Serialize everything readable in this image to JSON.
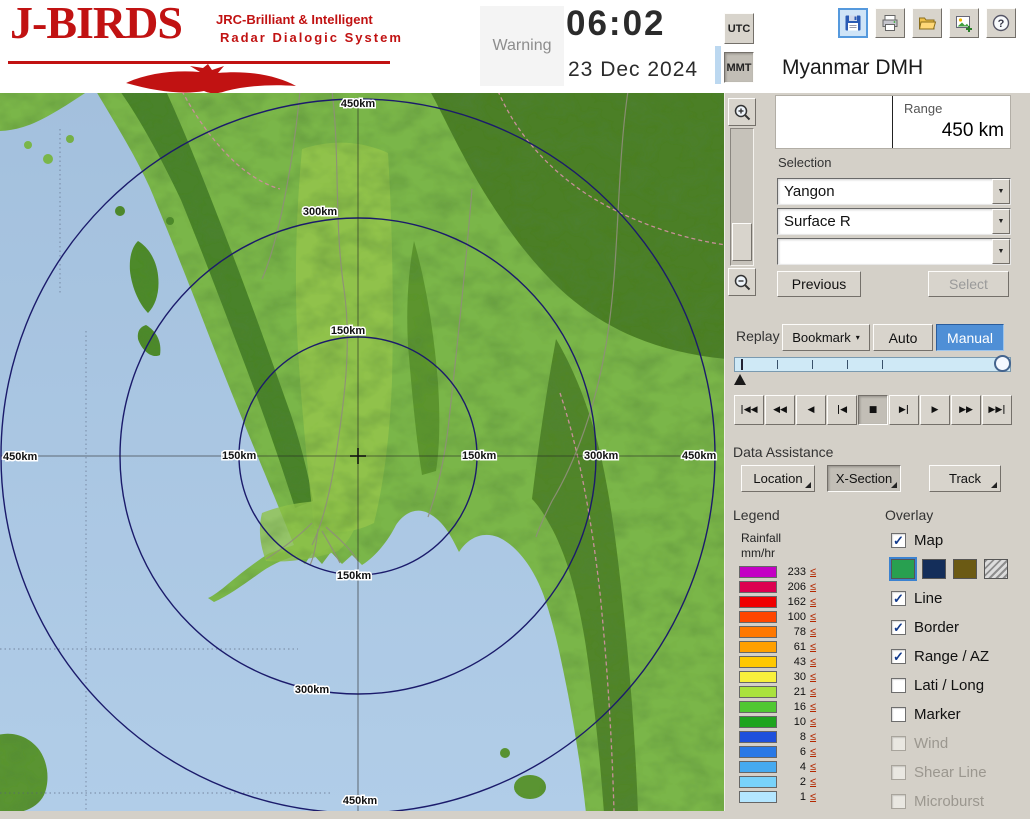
{
  "header": {
    "app_title": "J-BIRDS",
    "tagline_line1": "JRC-Brilliant & Intelligent",
    "tagline_line2": "Radar  Dialogic  System",
    "warning_label": "Warning",
    "time": "06:02",
    "date": "23 Dec 2024",
    "timezone_utc": "UTC",
    "timezone_mmt": "MMT",
    "selected_timezone": "MMT",
    "station_title": "Myanmar DMH",
    "toolbar_icons": [
      "save",
      "print",
      "open",
      "export",
      "help"
    ]
  },
  "range_panel": {
    "label": "Range",
    "value": "450 km"
  },
  "selection": {
    "label": "Selection",
    "dropdowns": [
      "Yangon",
      "Surface R",
      ""
    ],
    "previous_button": "Previous",
    "select_button": "Select",
    "select_enabled": false
  },
  "replay": {
    "label": "Replay",
    "bookmark_button": "Bookmark",
    "auto_button": "Auto",
    "manual_button": "Manual",
    "selected_mode": "Manual",
    "playback": [
      "|◀◀",
      "◀◀",
      "◀",
      "|◀",
      "■",
      "▶|",
      "▶",
      "▶▶",
      "▶▶|"
    ],
    "playback_names": [
      "skip-to-start",
      "fast-rewind",
      "play-reverse",
      "step-back",
      "stop",
      "step-forward",
      "play",
      "fast-forward",
      "skip-to-end"
    ],
    "pressed_index": 4
  },
  "data_assistance": {
    "label": "Data Assistance",
    "buttons": [
      "Location",
      "X-Section",
      "Track"
    ],
    "active_index": 1
  },
  "legend": {
    "title": "Legend",
    "parameter": "Rainfall",
    "unit": "mm/hr",
    "le_symbol": "≤",
    "entries": [
      {
        "value": "233",
        "color": "#c400c4"
      },
      {
        "value": "206",
        "color": "#dc0050"
      },
      {
        "value": "162",
        "color": "#f00000"
      },
      {
        "value": "100",
        "color": "#ff4600"
      },
      {
        "value": "78",
        "color": "#ff7800"
      },
      {
        "value": "61",
        "color": "#ffa000"
      },
      {
        "value": "43",
        "color": "#ffc800"
      },
      {
        "value": "30",
        "color": "#f8f03c"
      },
      {
        "value": "21",
        "color": "#aae23c"
      },
      {
        "value": "16",
        "color": "#50c832"
      },
      {
        "value": "10",
        "color": "#1ea41e"
      },
      {
        "value": "8",
        "color": "#1e50dc"
      },
      {
        "value": "6",
        "color": "#2878e6"
      },
      {
        "value": "4",
        "color": "#46aaf0"
      },
      {
        "value": "2",
        "color": "#78d2fa"
      },
      {
        "value": "1",
        "color": "#b4e6ff"
      }
    ]
  },
  "overlay": {
    "title": "Overlay",
    "items": [
      {
        "label": "Map",
        "checked": true,
        "enabled": true
      },
      {
        "label": "Line",
        "checked": true,
        "enabled": true
      },
      {
        "label": "Border",
        "checked": true,
        "enabled": true
      },
      {
        "label": "Range / AZ",
        "checked": true,
        "enabled": true
      },
      {
        "label": "Lati / Long",
        "checked": false,
        "enabled": true
      },
      {
        "label": "Marker",
        "checked": false,
        "enabled": true
      },
      {
        "label": "Wind",
        "checked": false,
        "enabled": false
      },
      {
        "label": "Shear Line",
        "checked": false,
        "enabled": false
      },
      {
        "label": "Microburst",
        "checked": false,
        "enabled": false
      }
    ],
    "map_style_swatches": [
      {
        "color": "#28a050",
        "selected": true
      },
      {
        "color": "#142e5a",
        "selected": false
      },
      {
        "color": "#6b5a14",
        "selected": false
      },
      {
        "color": "hatch",
        "selected": false
      }
    ]
  },
  "map": {
    "ring_labels": {
      "r150": "150km",
      "r300": "300km",
      "r450": "450km"
    }
  },
  "colors": {
    "accent_blue": "#316ac5",
    "logo_red": "#c11212",
    "panel_bg": "#d4d0c8",
    "sea": "#a7c4e0",
    "land_green": "#7ab648",
    "selected_mode_bg": "#4f8fd6"
  }
}
